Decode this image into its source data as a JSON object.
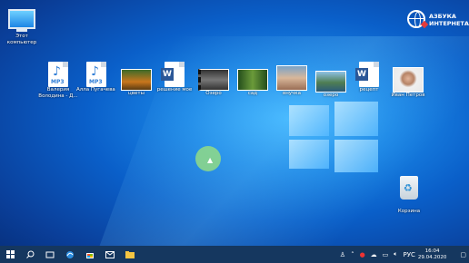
{
  "desktop": {
    "icons": [
      {
        "label": "Этот компьютер",
        "type": "pc"
      },
      {
        "label": "Валерия Володина - Д...",
        "type": "mp3"
      },
      {
        "label": "Алла Пугачева -...",
        "type": "mp3"
      },
      {
        "label": "цветы",
        "type": "photo"
      },
      {
        "label": "решение мое",
        "type": "word"
      },
      {
        "label": "Озеро",
        "type": "photo"
      },
      {
        "label": "сад",
        "type": "photo"
      },
      {
        "label": "внучка",
        "type": "photo"
      },
      {
        "label": "озеро",
        "type": "photo"
      },
      {
        "label": "рецепт",
        "type": "word"
      },
      {
        "label": "Иван Петров",
        "type": "photo"
      },
      {
        "label": "Корзина",
        "type": "trash"
      }
    ],
    "mp3_text": "MP3",
    "word_letter": "W"
  },
  "brand": {
    "line1": "АЗБУКА",
    "line2": "ИНТЕРНЕТА"
  },
  "taskbar": {
    "start_icon": "windows-start-icon",
    "search_icon": "search-icon",
    "language": "РУС",
    "time": "16:04",
    "date": "29.04.2020"
  },
  "colors": {
    "taskbar": "#15375f",
    "accent": "#1a86e6"
  }
}
